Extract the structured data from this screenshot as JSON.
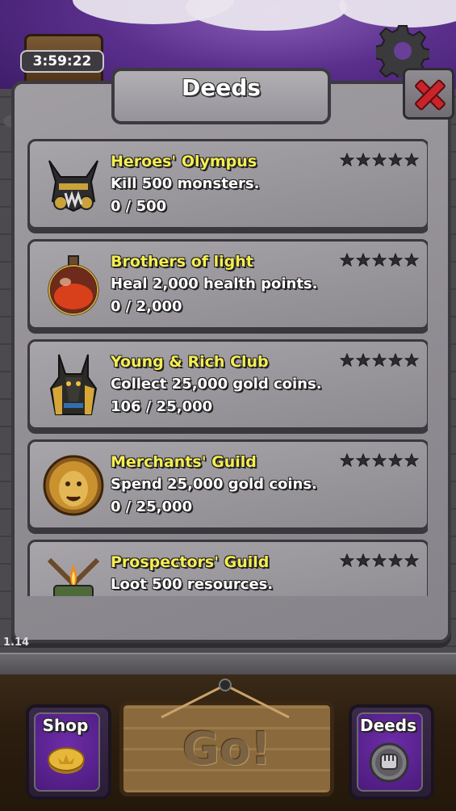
{
  "hud": {
    "timer": "3:59:22",
    "version": "1.14"
  },
  "dialog": {
    "title": "Deeds"
  },
  "deeds": [
    {
      "name": "Heroes' Olympus",
      "description": "Kill 500 monsters.",
      "progress": "0 / 500",
      "stars": 5,
      "icon": "horned-helmet-icon"
    },
    {
      "name": "Brothers of light",
      "description": "Heal 2,000 health points.",
      "progress": "0 / 2,000",
      "stars": 5,
      "icon": "health-potion-icon"
    },
    {
      "name": "Young & Rich Club",
      "description": "Collect 25,000 gold coins.",
      "progress": "106 / 25,000",
      "stars": 5,
      "icon": "anubis-mask-icon"
    },
    {
      "name": "Merchants' Guild",
      "description": "Spend 25,000 gold coins.",
      "progress": "0 / 25,000",
      "stars": 5,
      "icon": "lion-head-icon"
    },
    {
      "name": "Prospectors' Guild",
      "description": "Loot 500 resources.",
      "progress": "",
      "stars": 5,
      "icon": "crossed-pickaxes-icon"
    }
  ],
  "bottom_bar": {
    "shop_label": "Shop",
    "go_label": "Go!",
    "deeds_label": "Deeds"
  },
  "colors": {
    "deed_title": "#f6ee52",
    "close_red": "#c8242a",
    "purple_button": "#6d2ca8"
  }
}
